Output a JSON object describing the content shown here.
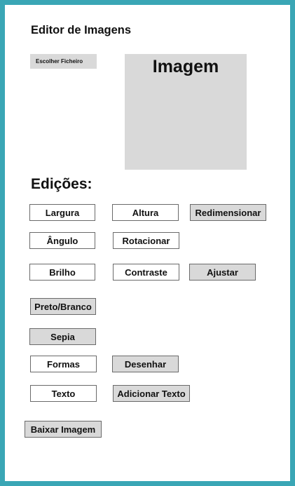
{
  "header": {
    "title": "Editor de Imagens"
  },
  "file": {
    "choose_label": "Escolher Ficheiro"
  },
  "preview": {
    "label": "Imagem"
  },
  "edits": {
    "title": "Edições:",
    "width_field": "Largura",
    "height_field": "Altura",
    "resize_button": "Redimensionar",
    "angle_field": "Ângulo",
    "rotate_button": "Rotacionar",
    "brightness_field": "Brilho",
    "contrast_field": "Contraste",
    "adjust_button": "Ajustar",
    "grayscale_button": "Preto/Branco",
    "sepia_button": "Sepia",
    "shapes_field": "Formas",
    "draw_button": "Desenhar",
    "text_field": "Texto",
    "add_text_button": "Adicionar Texto",
    "download_button": "Baixar Imagem"
  },
  "colors": {
    "frame": "#3aa6b5",
    "button_gray": "#d9d9d9",
    "border": "#6a6a6a"
  }
}
